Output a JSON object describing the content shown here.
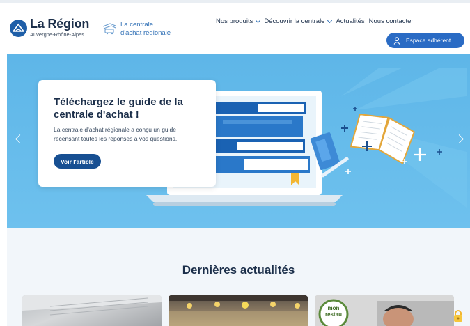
{
  "header": {
    "brand_title": "La Région",
    "brand_subtitle": "Auvergne-Rhône-Alpes",
    "centrale_line1": "La centrale",
    "centrale_line2": "d'achat régionale",
    "nav": [
      {
        "label": "Nos produits",
        "has_dropdown": true
      },
      {
        "label": "Découvrir la centrale",
        "has_dropdown": true
      },
      {
        "label": "Actualités",
        "has_dropdown": false
      },
      {
        "label": "Nous contacter",
        "has_dropdown": false
      }
    ],
    "member_button": "Espace adhérent"
  },
  "hero": {
    "title": "Téléchargez le guide de la centrale d'achat !",
    "text": "La centrale d'achat régionale a conçu un guide recensant toutes les réponses à vos questions.",
    "button": "Voir l'article"
  },
  "news": {
    "heading": "Dernières actualités",
    "thumb3_badge": "mon restau"
  },
  "colors": {
    "brand_blue": "#1f5fa8",
    "accent_blue": "#2a6bc4",
    "hero_bg": "#5eb6e8",
    "dark_text": "#1c2f4a"
  },
  "icons": [
    "logo-mark-icon",
    "centrale-icon",
    "chevron-down-icon",
    "user-icon",
    "chevron-left-icon",
    "chevron-right-icon",
    "lock-icon"
  ]
}
